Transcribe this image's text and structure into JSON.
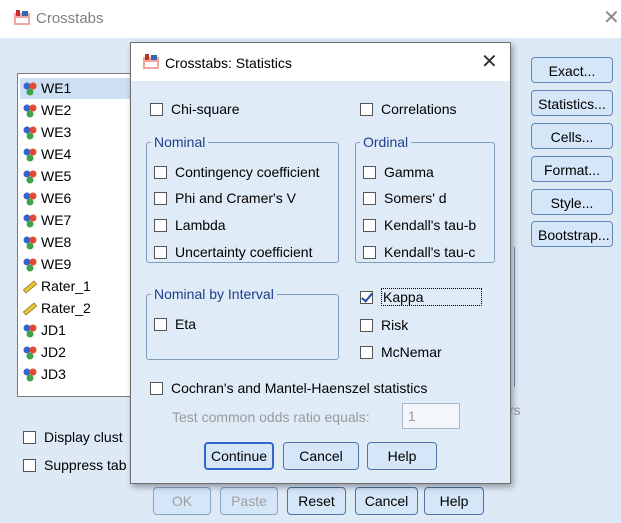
{
  "main_window": {
    "title": "Crosstabs",
    "variables": [
      "WE1",
      "WE2",
      "WE3",
      "WE4",
      "WE5",
      "WE6",
      "WE7",
      "WE8",
      "WE9",
      "Rater_1",
      "Rater_2",
      "JD1",
      "JD2",
      "JD3"
    ],
    "variable_types": [
      "nominal",
      "nominal",
      "nominal",
      "nominal",
      "nominal",
      "nominal",
      "nominal",
      "nominal",
      "nominal",
      "scale",
      "scale",
      "nominal",
      "nominal",
      "nominal"
    ],
    "side_buttons": [
      "Exact...",
      "Statistics...",
      "Cells...",
      "Format...",
      "Style...",
      "Bootstrap..."
    ],
    "display_clustered": "Display clust",
    "suppress_tables": "Suppress tab",
    "partial_rs": "rs",
    "bottom_buttons": {
      "ok": "OK",
      "paste": "Paste",
      "reset": "Reset",
      "cancel": "Cancel",
      "help": "Help"
    }
  },
  "dialog": {
    "title": "Crosstabs: Statistics",
    "chi_square": "Chi-square",
    "correlations": "Correlations",
    "nominal": {
      "legend": "Nominal",
      "items": [
        "Contingency coefficient",
        "Phi and Cramer's V",
        "Lambda",
        "Uncertainty coefficient"
      ]
    },
    "ordinal": {
      "legend": "Ordinal",
      "items": [
        "Gamma",
        "Somers' d",
        "Kendall's tau-b",
        "Kendall's tau-c"
      ]
    },
    "nominal_by_interval": {
      "legend": "Nominal by Interval",
      "eta": "Eta"
    },
    "kappa": {
      "label": "Kappa",
      "checked": true
    },
    "risk": "Risk",
    "mcnemar": "McNemar",
    "cochran": "Cochran's and Mantel-Haenszel statistics",
    "test_common_odds": "Test common odds ratio equals:",
    "odds_value": "1",
    "buttons": {
      "continue": "Continue",
      "cancel": "Cancel",
      "help": "Help"
    }
  },
  "colors": {
    "accent": "#1e3f8a",
    "window_bg": "#dee9f6",
    "button_bg": "#d6e6f9"
  }
}
